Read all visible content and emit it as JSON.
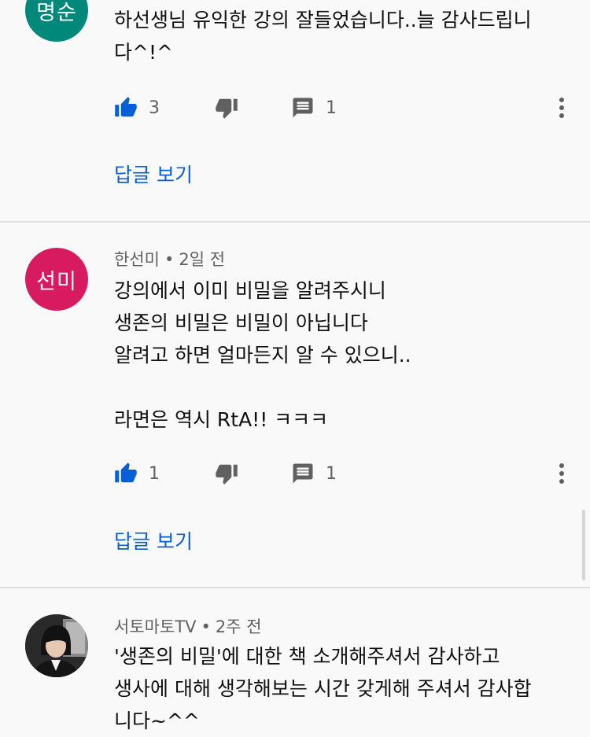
{
  "comments": [
    {
      "avatar_text": "명순",
      "avatar_color": "#00897b",
      "text": "하선생님  유익한 강의 잘들었습니다..늘 감사드립니\n다^!^",
      "likes": "3",
      "replies_count": "1",
      "view_replies": "답글 보기"
    },
    {
      "avatar_text": "선미",
      "avatar_color": "#d81b60",
      "author": "한선미",
      "time": "2일 전",
      "text": "강의에서 이미 비밀을 알려주시니\n생존의 비밀은 비밀이 아닙니다\n알려고 하면 얼마든지 알 수 있으니..\n\n라면은 역시 RtA!! ㅋㅋㅋ",
      "likes": "1",
      "replies_count": "1",
      "view_replies": "답글 보기"
    },
    {
      "author": "서토마토TV",
      "time": "2주 전",
      "text": "'생존의 비밀'에 대한 책 소개해주셔서 감사하고\n생사에 대해 생각해보는 시간 갖게해 주셔서 감사합\n니다~^^"
    }
  ],
  "meta_separator": "•",
  "colors": {
    "link": "#065fd4",
    "like_active": "#065fd4",
    "icon_gray": "#606060",
    "background": "#f9f9f9"
  }
}
